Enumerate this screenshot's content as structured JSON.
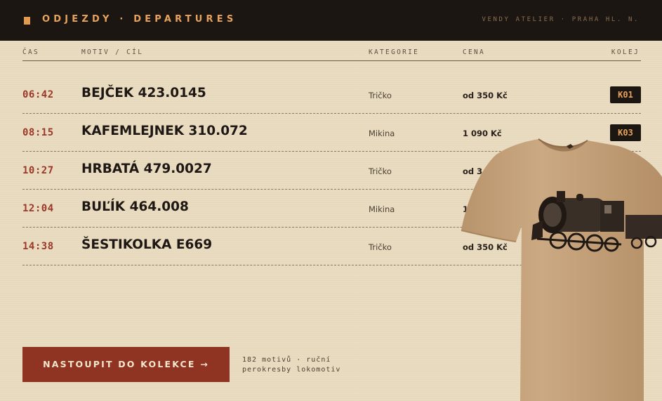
{
  "header": {
    "title": "ODJEZDY · DEPARTURES",
    "brand": "VENDY ATELIER · PRAHA HL. N."
  },
  "columns": {
    "time": "ČAS",
    "motif": "MOTIV / CÍL",
    "category": "KATEGORIE",
    "price": "CENA",
    "track": "KOLEJ"
  },
  "departures": [
    {
      "time": "06:42",
      "motif": "BEJČEK 423.0145",
      "category": "Tričko",
      "price": "od 350 Kč",
      "track": "K01"
    },
    {
      "time": "08:15",
      "motif": "KAFEMLEJNEK 310.072",
      "category": "Mikina",
      "price": "1 090 Kč",
      "track": "K03"
    },
    {
      "time": "10:27",
      "motif": "HRBATÁ 479.0027",
      "category": "Tričko",
      "price": "od 3",
      "track": ""
    },
    {
      "time": "12:04",
      "motif": "BUĽÍK 464.008",
      "category": "Mikina",
      "price": "1",
      "track": ""
    },
    {
      "time": "14:38",
      "motif": "ŠESTIKOLKA E669",
      "category": "Tričko",
      "price": "od 350 Kč",
      "track": ""
    }
  ],
  "cta": {
    "label": "NASTOUPIT DO KOLEKCE →",
    "note_line1": "182 motivů · ruční",
    "note_line2": "perokresby lokomotiv"
  },
  "product_image": {
    "icon": "steam-locomotive-tshirt",
    "shirt_color": "#c7a47e"
  },
  "colors": {
    "header_bg": "#1c1613",
    "accent_orange": "#e7a25c",
    "time_red": "#9b3727",
    "cta_red": "#8f3322",
    "paper": "#e9dcc1"
  }
}
